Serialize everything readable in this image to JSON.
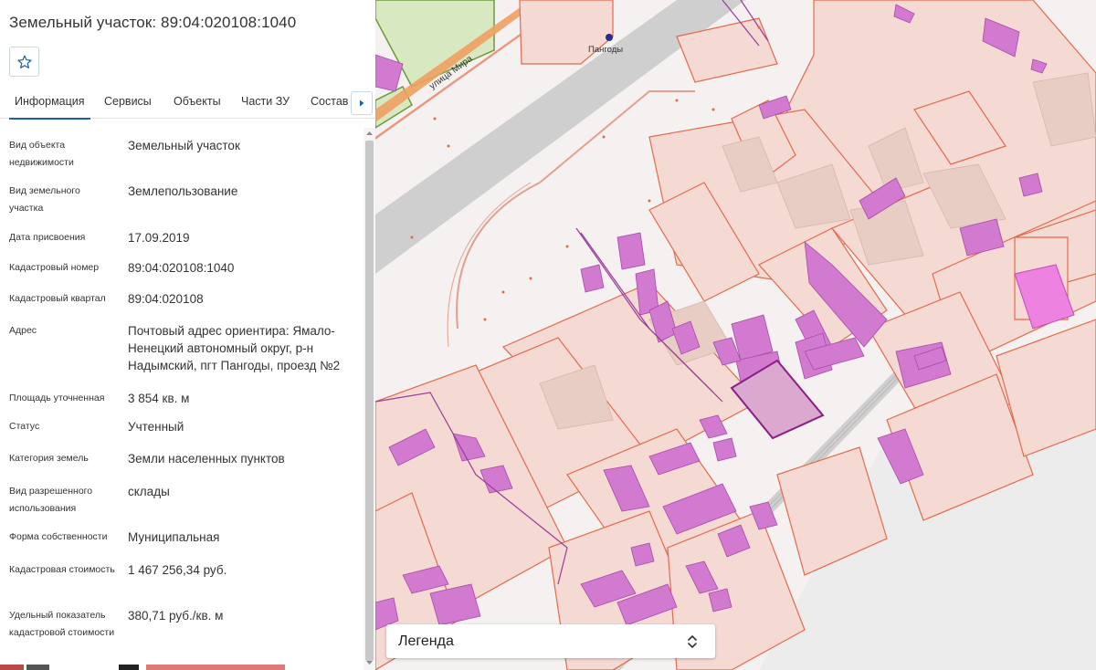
{
  "panel": {
    "title": "Земельный участок: 89:04:020108:1040",
    "favorite_icon": "star-outline-icon",
    "accent_color": "#1e5fa8"
  },
  "tabs": [
    {
      "label": "Информация",
      "active": true
    },
    {
      "label": "Сервисы",
      "active": false
    },
    {
      "label": "Объекты",
      "active": false
    },
    {
      "label": "Части ЗУ",
      "active": false
    },
    {
      "label": "Состав",
      "active": false
    }
  ],
  "tab_scroll_icon": "chevron-right-icon",
  "info": [
    {
      "label": "Вид объекта недвижимости",
      "value": "Земельный участок"
    },
    {
      "label": "Вид земельного участка",
      "value": "Землепользование"
    },
    {
      "label": "Дата присвоения",
      "value": "17.09.2019"
    },
    {
      "label": "Кадастровый номер",
      "value": "89:04:020108:1040"
    },
    {
      "label": "Кадастровый квартал",
      "value": "89:04:020108"
    },
    {
      "label": "Адрес",
      "value": "Почтовый адрес ориентира: Ямало-Ненецкий автономный округ, р-н Надымский, пгт Пангоды, проезд №2"
    },
    {
      "label": "Площадь уточненная",
      "value": "3 854 кв. м"
    },
    {
      "label": "Статус",
      "value": "Учтенный"
    },
    {
      "label": "Категория земель",
      "value": "Земли населенных пунктов"
    },
    {
      "label": "Вид разрешенного использования",
      "value": "склады"
    },
    {
      "label": "Форма собственности",
      "value": "Муниципальная"
    },
    {
      "label": "Кадастровая стоимость",
      "value": "1 467 256,34 руб."
    },
    {
      "label": "Удельный показатель кадастровой стоимости",
      "value": "380,71 руб./кв. м"
    }
  ],
  "map": {
    "place_label": "Пангоды",
    "street_label": "улица Мира",
    "parcel_fill": "#f5d9d3",
    "parcel_stroke": "#e26a4e",
    "building_fill": "#d17ad0",
    "selected_fill": "#dba8cf",
    "road_fill": "#cfcfcf"
  },
  "legend": {
    "label": "Легенда",
    "toggle_icon": "chevron-updown-icon"
  }
}
